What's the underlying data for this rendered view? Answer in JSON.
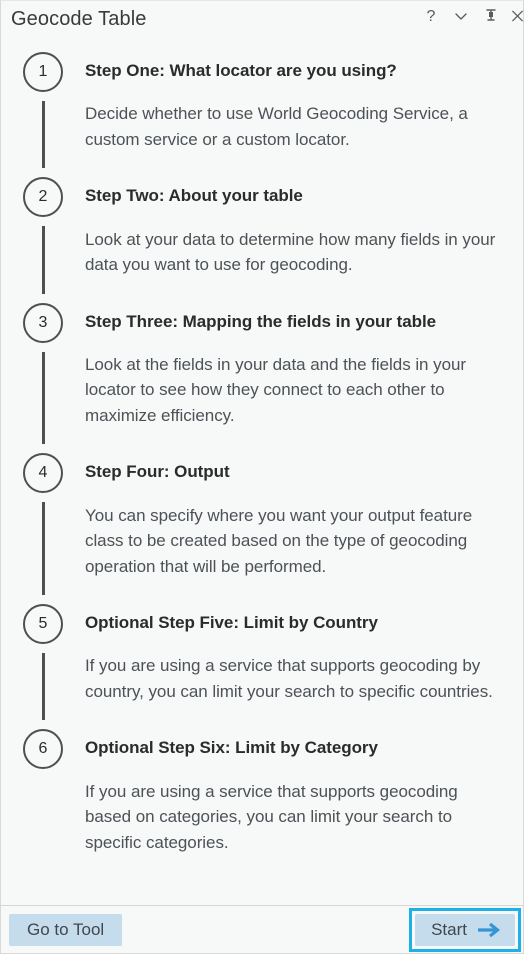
{
  "window": {
    "title": "Geocode Table",
    "actions": [
      {
        "name": "help-icon",
        "label": "?"
      },
      {
        "name": "chevron-down-icon",
        "label": ""
      },
      {
        "name": "pin-icon",
        "label": ""
      },
      {
        "name": "close-icon",
        "label": ""
      }
    ]
  },
  "colors": {
    "panel_background": "#f7f8f8",
    "text_primary": "#2b2b2b",
    "text_secondary": "#4d5257",
    "button_background": "#c5dced",
    "focus_ring": "#1fb0e8",
    "arrow_blue": "#3594d6",
    "circle_stroke": "#4f4f4f"
  },
  "steps": [
    {
      "number": "1",
      "title": "Step One: What locator are you using?",
      "description": "Decide whether to use World Geocoding Service, a custom service or a custom locator."
    },
    {
      "number": "2",
      "title": "Step Two: About your table",
      "description": "Look at your data to determine how many fields in your data you want to use for geocoding."
    },
    {
      "number": "3",
      "title": "Step Three: Mapping the fields in your table",
      "description": "Look at the fields in your data and the fields in your locator to see how they connect to each other to maximize efficiency."
    },
    {
      "number": "4",
      "title": "Step Four: Output",
      "description": "You can specify where you want your output feature class to be created based on the type of geocoding operation that will be performed."
    },
    {
      "number": "5",
      "title": "Optional Step Five: Limit by Country",
      "description": "If you are using a service that supports geocoding by country, you can limit your search to specific countries."
    },
    {
      "number": "6",
      "title": "Optional Step Six: Limit by Category",
      "description": "If you are using a service that supports geocoding based on categories, you can limit your search to specific categories."
    }
  ],
  "footer": {
    "go_to_tool_label": "Go to Tool",
    "start_label": "Start"
  }
}
